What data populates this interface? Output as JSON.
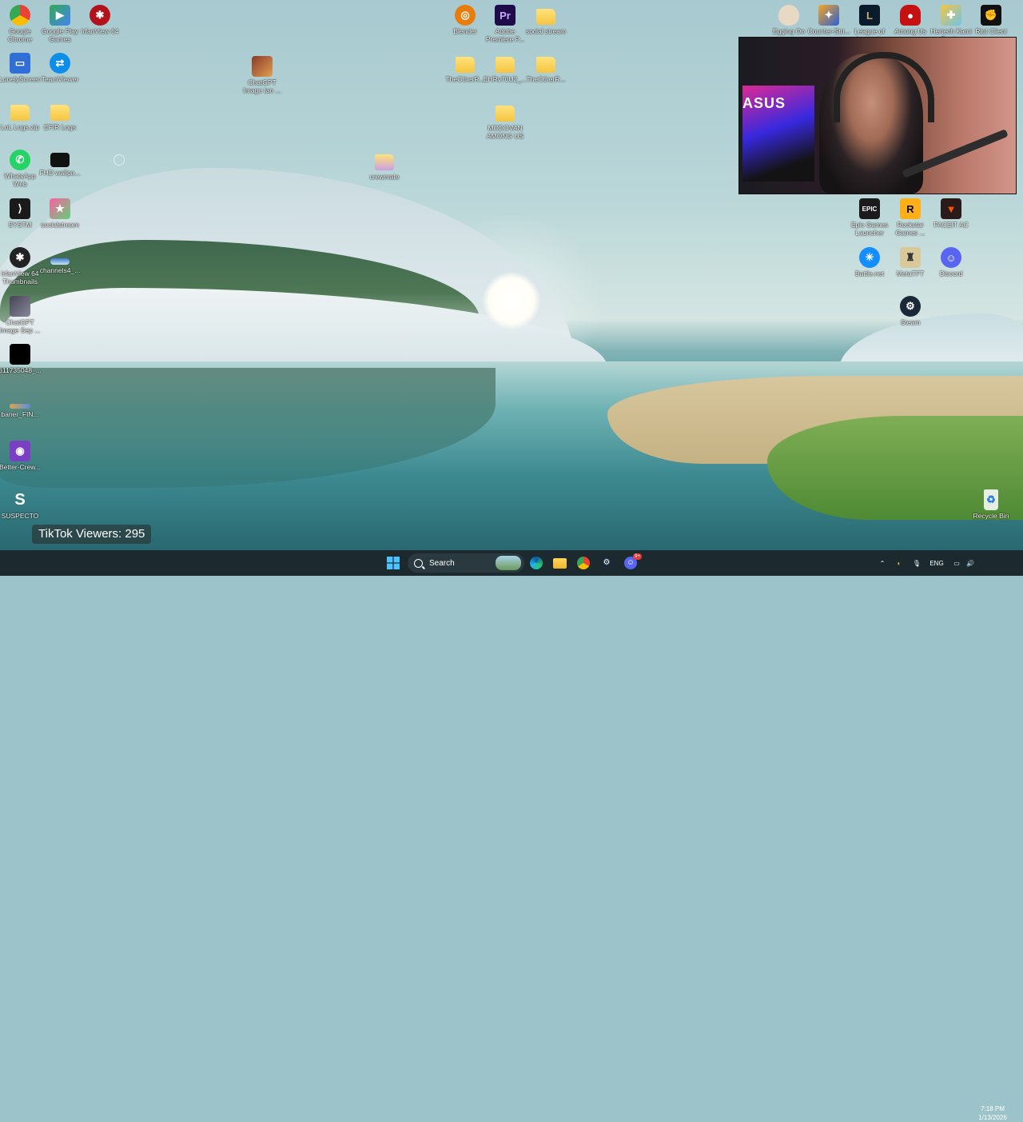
{
  "desktop": {
    "icons_left": [
      {
        "label": "Google Chrome",
        "icon": "chrome-icon"
      },
      {
        "label": "Google Play Games",
        "icon": "google-play-games-icon"
      },
      {
        "label": "IrfanView 64",
        "icon": "irfanview-icon"
      },
      {
        "label": "LonelyScreen",
        "icon": "lonelyscreen-icon"
      },
      {
        "label": "TeamViewer",
        "icon": "teamviewer-icon"
      },
      {
        "label": "LoL Logs.zip",
        "icon": "zip-folder-icon"
      },
      {
        "label": "EFIR Logs",
        "icon": "folder-icon"
      },
      {
        "label": "WhatsApp Web",
        "icon": "whatsapp-icon"
      },
      {
        "label": "FHD wallpa...",
        "icon": "image-file-icon"
      },
      {
        "label": "SYSTM",
        "icon": "systm-icon"
      },
      {
        "label": "socialstream",
        "icon": "socialstream-icon"
      },
      {
        "label": "IrfanView 64 Thumbnails",
        "icon": "irfanview-thumbnails-icon"
      },
      {
        "label": "channels4_...",
        "icon": "image-file-icon"
      },
      {
        "label": "ChatGPT Image Sep ...",
        "icon": "image-file-icon"
      },
      {
        "label": "611735048_...",
        "icon": "image-file-icon"
      },
      {
        "label": "baner_FIN...",
        "icon": "image-file-icon"
      },
      {
        "label": "Better-Crew...",
        "icon": "better-crewlink-icon"
      },
      {
        "label": "SUSPECTO",
        "icon": "suspecto-icon"
      }
    ],
    "icons_middle": [
      {
        "label": "ChatGPT Image Ian ...",
        "icon": "image-file-icon"
      },
      {
        "label": "crewmate",
        "icon": "crewmate-icon"
      },
      {
        "label": "Blender",
        "icon": "blender-icon"
      },
      {
        "label": "Adobe Premiere P...",
        "icon": "premiere-icon"
      },
      {
        "label": "social stream",
        "icon": "folder-icon"
      },
      {
        "label": "TheOtherR...",
        "icon": "folder-icon"
      },
      {
        "label": "EHRv70U2_...",
        "icon": "folder-icon"
      },
      {
        "label": "TheOtherR...",
        "icon": "folder-icon"
      },
      {
        "label": "MODOVAN AMONG US",
        "icon": "folder-icon"
      }
    ],
    "icons_right": [
      {
        "label": "Egging On",
        "icon": "egging-on-icon"
      },
      {
        "label": "Counter-Stri...",
        "icon": "counter-strike-icon"
      },
      {
        "label": "League of Legends",
        "icon": "league-of-legends-icon"
      },
      {
        "label": "Among Us",
        "icon": "among-us-icon"
      },
      {
        "label": "Hertech Kami Pred...",
        "icon": "hertech-icon"
      },
      {
        "label": "Riot Client",
        "icon": "riot-client-icon"
      },
      {
        "label": "Epic Games Launcher",
        "icon": "epic-games-icon"
      },
      {
        "label": "Rockstar Games ...",
        "icon": "rockstar-icon"
      },
      {
        "label": "FACEIT AC",
        "icon": "faceit-icon"
      },
      {
        "label": "Battle.net",
        "icon": "battlenet-icon"
      },
      {
        "label": "MetaTFT",
        "icon": "metatft-icon"
      },
      {
        "label": "Discord",
        "icon": "discord-icon"
      },
      {
        "label": "Steam",
        "icon": "steam-icon"
      },
      {
        "label": "Recycle Bin",
        "icon": "recycle-bin-icon"
      }
    ]
  },
  "overlay": {
    "webcam_brand_text": "ASUS",
    "tiktok_viewers": "TikTok Viewers: 295"
  },
  "taskbar": {
    "search_placeholder": "Search",
    "apps": [
      "start-icon",
      "edge-icon",
      "file-explorer-icon",
      "chrome-icon",
      "steam-icon",
      "discord-icon"
    ],
    "discord_badge": "9+",
    "tray": {
      "language": "ENG",
      "time": "7:18 PM",
      "date": "1/13/2026"
    }
  },
  "colors": {
    "taskbar_bg": "#1c2a30",
    "folder": "#f5c542",
    "accent_blue": "#0078d4"
  }
}
